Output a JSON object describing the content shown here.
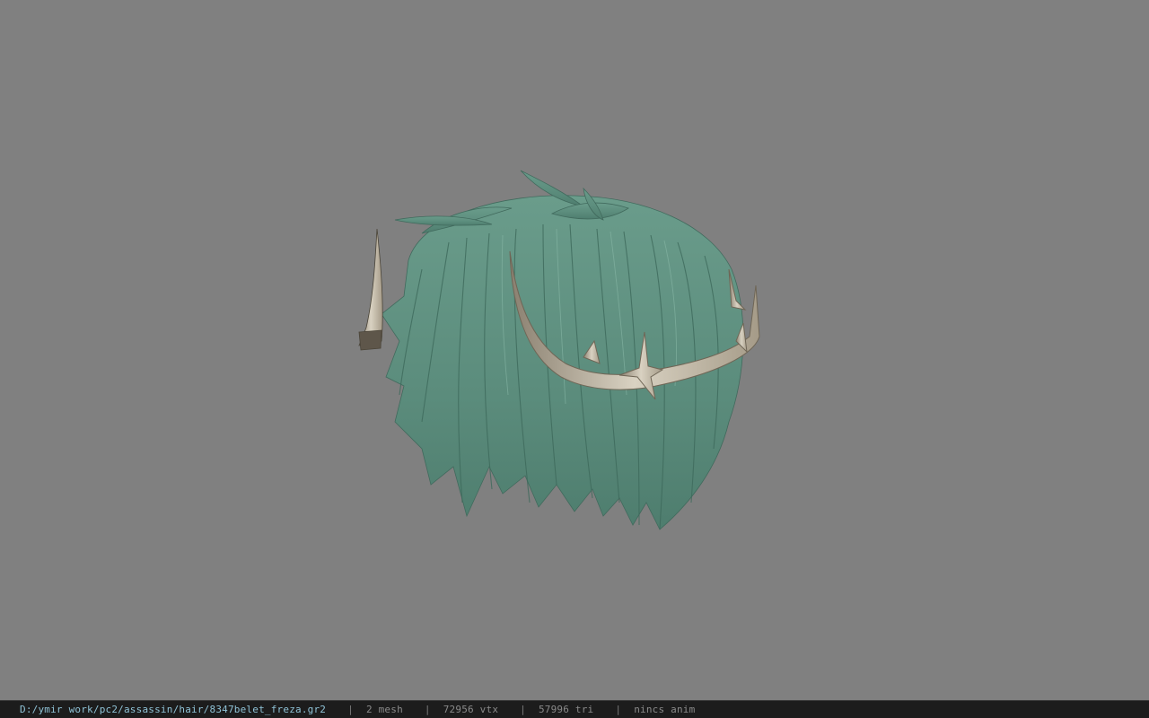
{
  "viewer": {
    "background_color": "#808080",
    "model_icon": "hair-mesh-model",
    "hair_color": "#5f9080",
    "ornament_color": "#c9c1b0"
  },
  "status": {
    "path": "D:/ymir work/pc2/assassin/hair/8347belet_freza.gr2",
    "mesh": "2 mesh",
    "vtx": "72956 vtx",
    "tri": "57996 tri",
    "anim": "nincs anim",
    "separator": "|"
  }
}
